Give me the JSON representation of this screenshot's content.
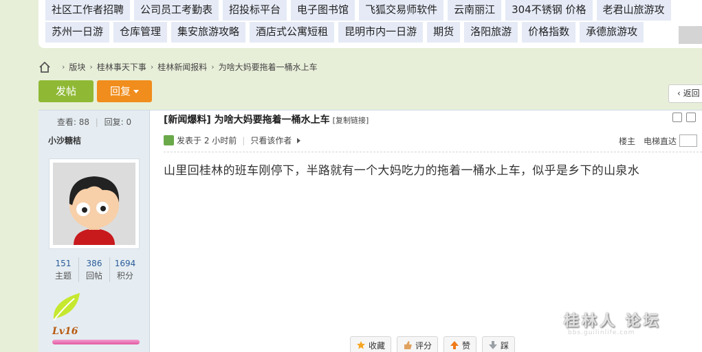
{
  "top_links": {
    "row1": [
      "社区工作者招聘",
      "公司员工考勤表",
      "招投标平台",
      "电子图书馆",
      "飞狐交易师软件",
      "云南丽江",
      "304不锈钢  价格",
      "老君山旅游攻"
    ],
    "row2": [
      "苏州一日游",
      "仓库管理",
      "集安旅游攻略",
      "酒店式公寓短租",
      "昆明市内一日游",
      "期货",
      "洛阳旅游",
      "价格指数",
      "承德旅游攻"
    ]
  },
  "breadcrumb": [
    "版块",
    "桂林事天下事",
    "桂林新闻报料",
    "为啥大妈要拖着一桶水上车"
  ],
  "buttons": {
    "post": "发帖",
    "reply": "回复",
    "back": "返回"
  },
  "sidebar": {
    "views_label": "查看:",
    "views": "88",
    "replies_label": "回复:",
    "replies": "0",
    "username": "小沙糖桔",
    "stats": [
      {
        "value": "151",
        "label": "主题"
      },
      {
        "value": "386",
        "label": "回帖"
      },
      {
        "value": "1694",
        "label": "积分"
      }
    ],
    "level": "Lv16",
    "level_progress": 1.0
  },
  "post": {
    "title": "[新闻爆料] 为啥大妈要拖着一桶水上车",
    "copy_link": "[复制链接]",
    "posted": "发表于 2 小时前",
    "only_author": "只看该作者",
    "floor": "楼主",
    "jump_label": "电梯直达",
    "body": "山里回桂林的班车刚停下，半路就有一个大妈吃力的拖着一桶水上车，似乎是乡下的山泉水"
  },
  "actions": [
    "收藏",
    "评分",
    "赞",
    "踩"
  ],
  "watermark": {
    "main": "桂林人 论坛",
    "sub": "bbs.guilinlife.com"
  },
  "colors": {
    "post_button": "#8fb935",
    "reply_button": "#f18d1c",
    "link_bg": "#e5eaf6",
    "sidebar_bg": "#e5edf2",
    "page_bg": "#e8efd9"
  }
}
